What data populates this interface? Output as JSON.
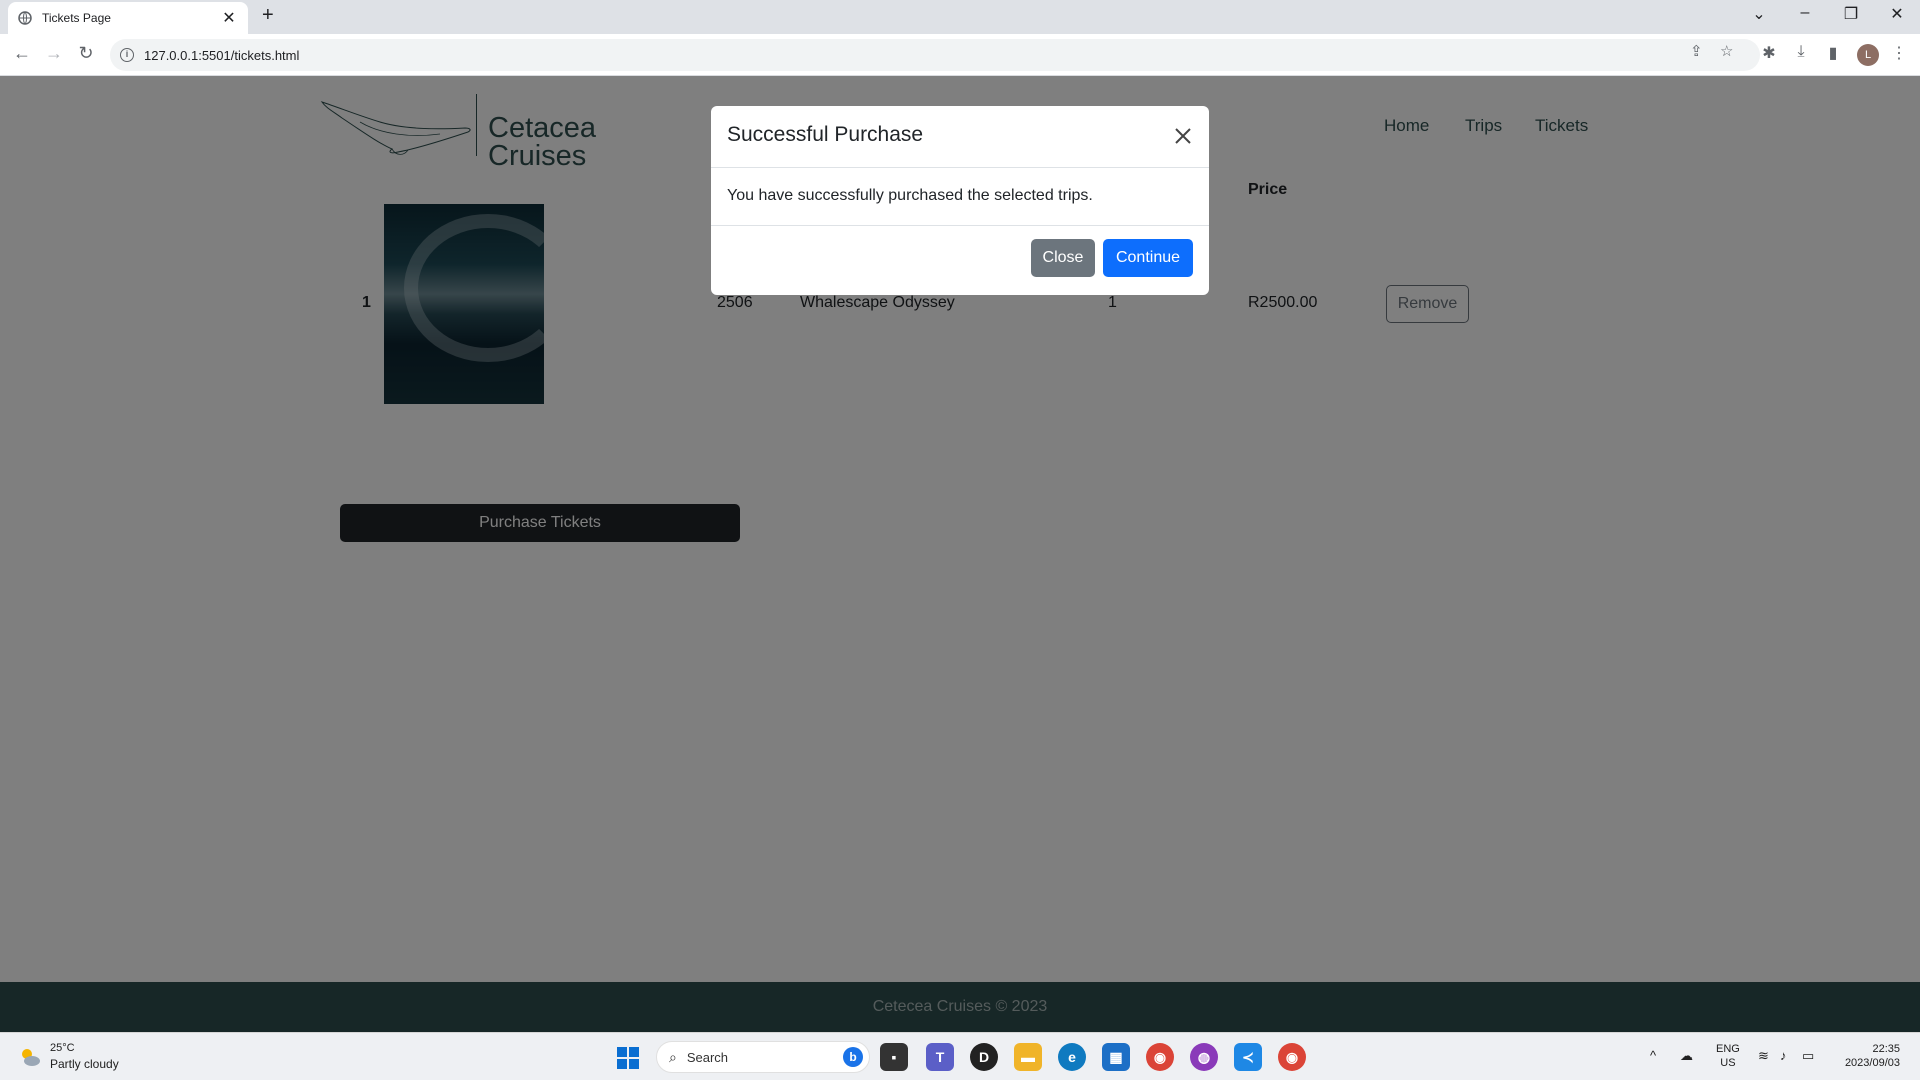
{
  "browser": {
    "tab_title": "Tickets Page",
    "tab_close": "✕",
    "new_tab": "+",
    "url": "127.0.0.1:5501/tickets.html"
  },
  "site": {
    "brand_line1": "Cetacea",
    "brand_line2": "Cruises",
    "nav": [
      "Home",
      "Trips",
      "Tickets"
    ],
    "table_header_price": "Price",
    "row": {
      "index": "1",
      "trip_id": "2506",
      "trip_name": "Whalescape Odyssey",
      "quantity": "1",
      "price": "R2500.00",
      "remove_label": "Remove"
    },
    "purchase_label": "Purchase Tickets",
    "footer": "Cetecea Cruises © 2023"
  },
  "modal": {
    "title": "Successful Purchase",
    "body": "You have successfully purchased the selected trips.",
    "close_label": "Close",
    "continue_label": "Continue"
  },
  "taskbar": {
    "weather_temp": "25°C",
    "weather_desc": "Partly cloudy",
    "search_label": "Search",
    "lang_line1": "ENG",
    "lang_line2": "US",
    "time": "22:35",
    "date": "2023/09/03"
  },
  "colors": {
    "brand": "#2f4f4f",
    "primary": "#0d6efd",
    "secondary": "#6c757d",
    "dark": "#212529"
  }
}
